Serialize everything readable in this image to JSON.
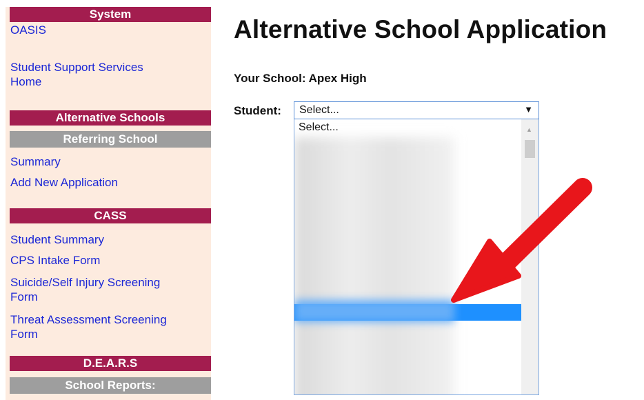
{
  "sidebar": {
    "system_header": "System",
    "system_links": [
      "OASIS",
      "Student Support Services",
      "Home"
    ],
    "alt_header": "Alternative Schools",
    "alt_subheader": "Referring School",
    "alt_links": [
      "Summary",
      "Add New Application"
    ],
    "cass_header": "CASS",
    "cass_links": [
      "Student Summary",
      "CPS Intake Form",
      "Suicide/Self Injury Screening",
      "Form",
      "Threat Assessment Screening",
      "Form"
    ],
    "dears_header": "D.E.A.R.S",
    "dears_subheader": "School Reports:"
  },
  "main": {
    "title": "Alternative School Application",
    "school_line": "Your School: Apex High",
    "student_label": "Student:",
    "select_value": "Select...",
    "first_option": "Select..."
  },
  "colors": {
    "header_bg": "#a31d4f",
    "sidebar_bg": "#fdebdf",
    "link": "#1b26d6",
    "highlight": "#1e90ff",
    "arrow": "#e8161b"
  },
  "icons": {
    "select_arrow": "chevron-down-icon",
    "scroll_up": "scroll-up-icon",
    "annotation_arrow": "red-arrow-icon"
  }
}
